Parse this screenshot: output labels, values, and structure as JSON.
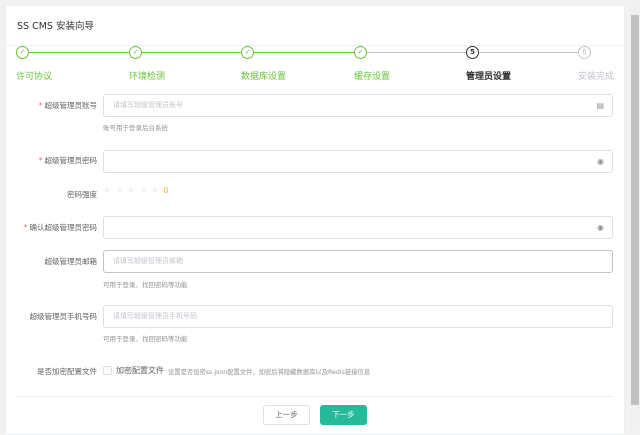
{
  "title": "SS CMS 安装向导",
  "steps": [
    {
      "label": "许可协议",
      "state": "done"
    },
    {
      "label": "环境检测",
      "state": "done"
    },
    {
      "label": "数据库设置",
      "state": "done"
    },
    {
      "label": "缓存设置",
      "state": "done"
    },
    {
      "label": "管理员设置",
      "state": "active",
      "num": "5"
    },
    {
      "label": "安装完成",
      "state": "pending",
      "num": "6"
    }
  ],
  "form": {
    "account": {
      "label": "超级管理员账号",
      "placeholder": "请填写超级管理员账号",
      "hint": "账号用于登录后台系统"
    },
    "password": {
      "label": "超级管理员密码"
    },
    "strength": {
      "label": "密码强度",
      "value": "0",
      "stars": 0
    },
    "confirm": {
      "label": "确认超级管理员密码"
    },
    "email": {
      "label": "超级管理员邮箱",
      "placeholder": "请填写超级管理员邮箱",
      "hint": "可用于登录、找回密码等功能"
    },
    "phone": {
      "label": "超级管理员手机号码",
      "placeholder": "请填写超级管理员手机号码",
      "hint": "可用于登录、找回密码等功能"
    },
    "encrypt": {
      "label": "是否加密配置文件",
      "checkbox_label": "加密配置文件",
      "desc": "设置是否加密ss.json配置文件，加密后将隐藏数据库以及Redis链接信息"
    }
  },
  "buttons": {
    "prev": "上一步",
    "next": "下一步"
  },
  "colors": {
    "success": "#67c23a",
    "primary": "#26b99a",
    "required": "#f56c6c",
    "strength": "#f7ba2a"
  }
}
